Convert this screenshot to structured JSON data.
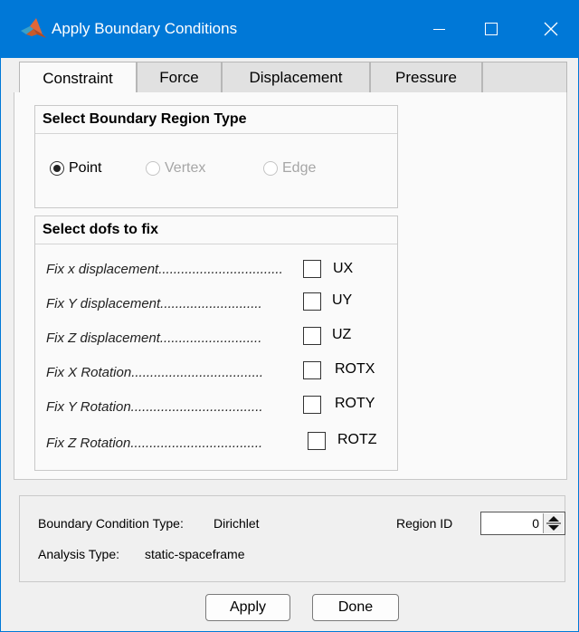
{
  "window": {
    "title": "Apply Boundary Conditions"
  },
  "tabs": [
    {
      "label": "Constraint"
    },
    {
      "label": "Force"
    },
    {
      "label": "Displacement"
    },
    {
      "label": "Pressure"
    }
  ],
  "region_group": {
    "title": "Select Boundary Region Type",
    "options": [
      {
        "label": "Point",
        "selected": true,
        "enabled": true
      },
      {
        "label": "Vertex",
        "selected": false,
        "enabled": false
      },
      {
        "label": "Edge",
        "selected": false,
        "enabled": false
      }
    ]
  },
  "dofs_group": {
    "title": "Select dofs to fix",
    "rows": [
      {
        "label": "Fix x displacement.................................",
        "name": "UX",
        "checked": false
      },
      {
        "label": "Fix Y displacement...........................",
        "name": "UY",
        "checked": false
      },
      {
        "label": "Fix Z displacement...........................",
        "name": "UZ",
        "checked": false
      },
      {
        "label": "Fix X Rotation...................................",
        "name": "ROTX",
        "checked": false
      },
      {
        "label": "Fix Y Rotation...................................",
        "name": "ROTY",
        "checked": false
      },
      {
        "label": "Fix Z Rotation...................................",
        "name": "ROTZ",
        "checked": false
      }
    ]
  },
  "info": {
    "bc_type_label": "Boundary Condition Type:",
    "bc_type_value": "Dirichlet",
    "analysis_label": "Analysis Type:",
    "analysis_value": "static-spaceframe",
    "region_id_label": "Region ID",
    "region_id_value": "0"
  },
  "buttons": {
    "apply": "Apply",
    "done": "Done"
  },
  "colors": {
    "titlebar": "#0078d7"
  }
}
